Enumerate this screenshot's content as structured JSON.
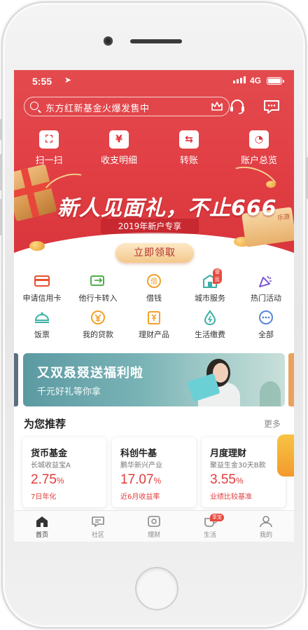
{
  "status_bar": {
    "time": "5:55",
    "network": "4G"
  },
  "search": {
    "placeholder": "东方红新基金火爆发售中"
  },
  "quick_actions": [
    {
      "label": "扫一扫",
      "icon": "scan-icon"
    },
    {
      "label": "收支明细",
      "icon": "yen-bill-icon"
    },
    {
      "label": "转账",
      "icon": "transfer-icon"
    },
    {
      "label": "账户总览",
      "icon": "account-overview-icon"
    }
  ],
  "banner": {
    "title": "新人见面礼，不止666",
    "subtitle": "2019年新户专享",
    "button": "立即领取",
    "envelope_text": "乐游"
  },
  "services": [
    {
      "label": "申请信用卡",
      "icon": "credit-card-icon"
    },
    {
      "label": "他行卡转入",
      "icon": "card-transfer-in-icon"
    },
    {
      "label": "借钱",
      "icon": "borrow-icon"
    },
    {
      "label": "城市服务",
      "icon": "city-service-icon",
      "badge": "便民"
    },
    {
      "label": "热门活动",
      "icon": "hot-activity-icon"
    },
    {
      "label": "饭票",
      "icon": "meal-ticket-icon"
    },
    {
      "label": "我的贷款",
      "icon": "my-loan-icon"
    },
    {
      "label": "理财产品",
      "icon": "wealth-product-icon"
    },
    {
      "label": "生活缴费",
      "icon": "utility-payment-icon"
    },
    {
      "label": "全部",
      "icon": "more-icon"
    }
  ],
  "promo": {
    "title": "又双叒叕送福利啦",
    "subtitle": "千元好礼等你拿"
  },
  "recommend": {
    "title": "为您推荐",
    "more": "更多",
    "cards": [
      {
        "name": "货币基金",
        "fund": "长城收益宝A",
        "rate": "2.75",
        "unit": "%",
        "note": "7日年化"
      },
      {
        "name": "科创牛基",
        "fund": "鹏华新兴产业",
        "rate": "17.07",
        "unit": "%",
        "note": "近6月收益率"
      },
      {
        "name": "月度理财",
        "fund": "聚益生金30天B款",
        "rate": "3.55",
        "unit": "%",
        "note": "业绩比较基准"
      }
    ]
  },
  "tabs": [
    {
      "label": "首页",
      "icon": "home-icon",
      "active": true
    },
    {
      "label": "社区",
      "icon": "community-icon"
    },
    {
      "label": "理财",
      "icon": "wealth-icon"
    },
    {
      "label": "生活",
      "icon": "life-icon",
      "badge": "享宝"
    },
    {
      "label": "我的",
      "icon": "profile-icon"
    }
  ],
  "colors": {
    "brand_red": "#e13e44",
    "rate_red": "#e23b3b",
    "claim_gold": "#f3c88b"
  }
}
